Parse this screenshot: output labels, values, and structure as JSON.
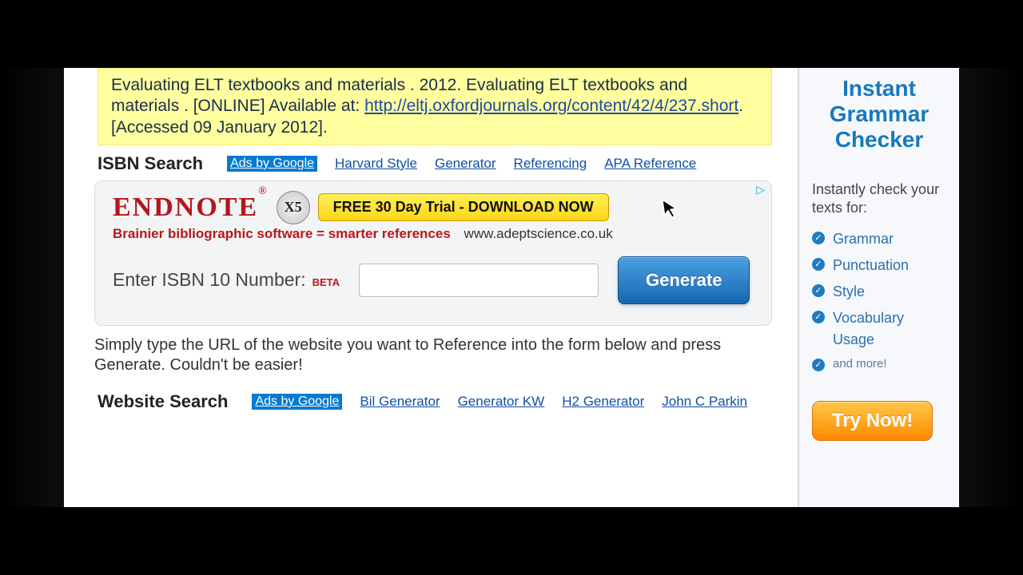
{
  "citation": {
    "text_before": "Evaluating ELT textbooks and materials . 2012. Evaluating ELT textbooks and materials . [ONLINE] Available at: ",
    "url": "http://eltj.oxfordjournals.org/content/42/4/237.short",
    "text_after": ". [Accessed 09 January 2012]."
  },
  "isbn_section": {
    "title": "ISBN Search",
    "ads_label": "Ads by Google",
    "ad_links": [
      "Harvard Style",
      "Generator",
      "Referencing",
      "APA Reference"
    ],
    "endnote": {
      "name": "ENDNOTE",
      "badge": "X5",
      "download_button": "FREE 30 Day Trial - DOWNLOAD NOW",
      "tagline": "Brainier bibliographic software = smarter references",
      "domain": "www.adeptscience.co.uk"
    },
    "isbn_label": "Enter ISBN 10 Number:",
    "beta": "BETA",
    "isbn_value": "",
    "generate_button": "Generate"
  },
  "helper_text": "Simply type the URL of the website you want to Reference into the form below and press Generate. Couldn't be easier!",
  "website_section": {
    "title": "Website Search",
    "ads_label": "Ads by Google",
    "ad_links": [
      "Bil Generator",
      "Generator KW",
      "H2 Generator",
      "John C Parkin"
    ]
  },
  "sidebar": {
    "title_line1": "Instant",
    "title_line2": "Grammar",
    "title_line3": "Checker",
    "subtitle": "Instantly check your texts for:",
    "items": [
      "Grammar",
      "Punctuation",
      "Style",
      "Vocabulary Usage"
    ],
    "more": "and more!",
    "try_button": "Try Now!"
  }
}
